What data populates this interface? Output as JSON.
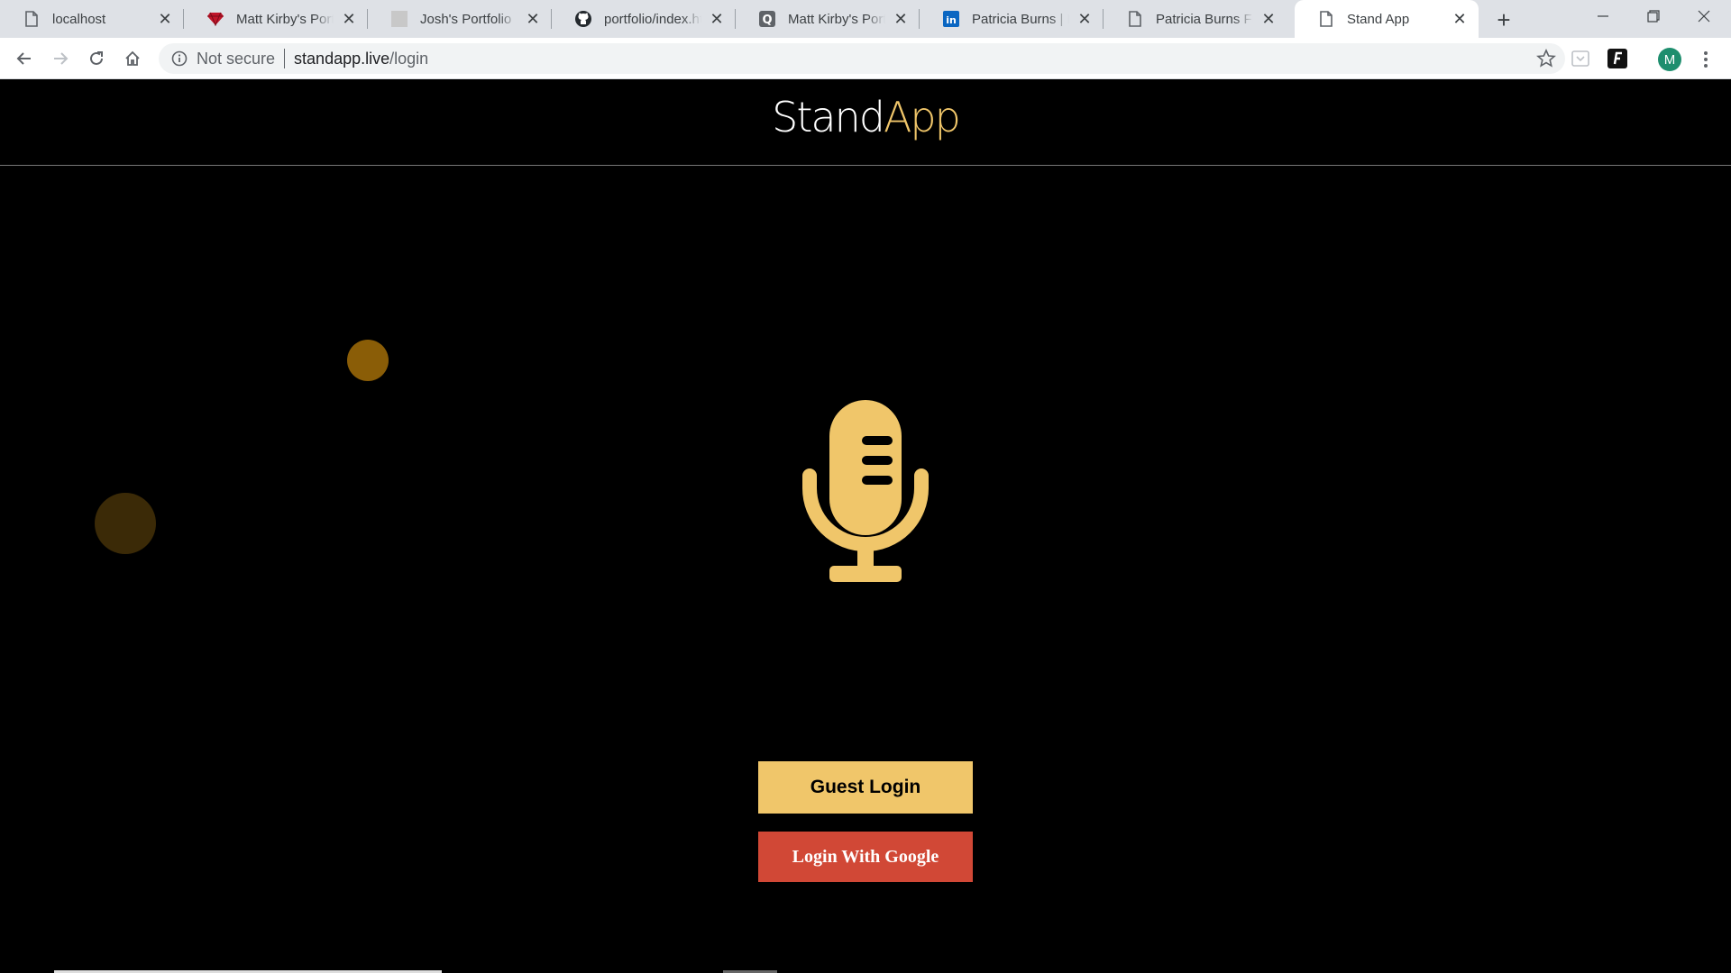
{
  "browser": {
    "tabs": [
      {
        "title": "localhost",
        "icon": "page-icon",
        "active": false
      },
      {
        "title": "Matt Kirby's Portfolio",
        "icon": "ruby-gem-icon",
        "active": false
      },
      {
        "title": "Josh's Portfolio",
        "icon": "blank-square-icon",
        "active": false
      },
      {
        "title": "portfolio/index.html",
        "icon": "github-icon",
        "active": false
      },
      {
        "title": "Matt Kirby's Portfolio",
        "icon": "logo-q-icon",
        "active": false
      },
      {
        "title": "Patricia Burns | LinkedIn",
        "icon": "linkedin-icon",
        "active": false
      },
      {
        "title": "Patricia Burns Front",
        "icon": "page-icon",
        "active": false
      },
      {
        "title": "Stand App",
        "icon": "page-icon",
        "active": true
      }
    ],
    "new_tab_label": "+",
    "address": {
      "security_label": "Not secure",
      "host": "standapp.live",
      "path": "/login"
    },
    "profile_initial": "M"
  },
  "page": {
    "logo": {
      "part1": "Stand",
      "part2": "App"
    },
    "buttons": {
      "guest_login": "Guest Login",
      "google_login": "Login With Google"
    }
  },
  "colors": {
    "accent_gold": "#f0c66a",
    "google_red": "#d14836",
    "background": "#000000"
  }
}
